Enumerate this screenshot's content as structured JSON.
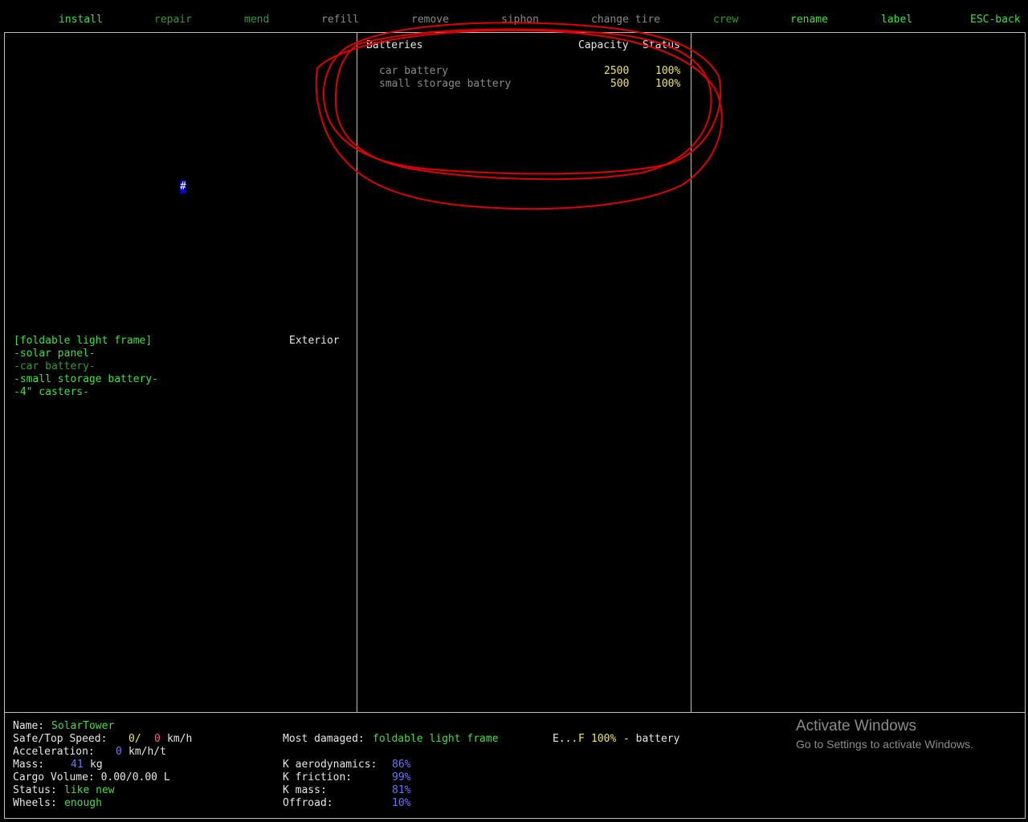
{
  "menu": [
    {
      "key": "install",
      "label": "install",
      "color": "green"
    },
    {
      "key": "repair",
      "label": "repair",
      "color": "dgreen"
    },
    {
      "key": "mend",
      "label": "mend",
      "color": "dgreen"
    },
    {
      "key": "refill",
      "label": "refill",
      "color": "gray"
    },
    {
      "key": "remove",
      "label": "remove",
      "color": "gray"
    },
    {
      "key": "siphon",
      "label": "siphon",
      "color": "gray"
    },
    {
      "key": "change_tire",
      "label": "change tire",
      "color": "gray"
    },
    {
      "key": "crew",
      "label": "crew",
      "color": "dgreen"
    },
    {
      "key": "rename",
      "label": "rename",
      "color": "green"
    },
    {
      "key": "label",
      "label": "label",
      "color": "green"
    },
    {
      "key": "esc_back",
      "label": "ESC-back",
      "color": "green"
    }
  ],
  "map": {
    "cursor_char": "#"
  },
  "parts": {
    "location": "Exterior",
    "items": [
      {
        "label": "[foldable light frame]",
        "color": "green"
      },
      {
        "label": "-solar panel-",
        "color": "green"
      },
      {
        "label": "-car battery-",
        "color": "dgreen"
      },
      {
        "label": "-small storage battery-",
        "color": "green"
      },
      {
        "label": "-4\" casters-",
        "color": "green"
      }
    ]
  },
  "batteries": {
    "header_name": "Batteries",
    "header_capacity": "Capacity",
    "header_status": "Status",
    "rows": [
      {
        "name": "car battery",
        "capacity": "2500",
        "status": "100%"
      },
      {
        "name": "small storage battery",
        "capacity": "500",
        "status": "100%"
      }
    ]
  },
  "stats": {
    "name_label": "Name: ",
    "name_value": "SolarTower",
    "speed_label": "Safe/Top Speed:",
    "speed_safe": "0/",
    "speed_top": "0",
    "speed_unit": "km/h",
    "accel_label": "Acceleration:",
    "accel_value": "0",
    "accel_unit": "km/h/t",
    "mass_label": "Mass:",
    "mass_value": "41",
    "mass_unit": "kg",
    "cargo": "Cargo Volume: 0.00/0.00 L",
    "status_label": "Status: ",
    "status_value": "like new",
    "wheels_label": "Wheels: ",
    "wheels_value": "enough",
    "damaged_label": "Most damaged: ",
    "damaged_value": "foldable light frame",
    "fuel_e": "E...",
    "fuel_f": "F",
    "fuel_pct": "100%",
    "fuel_type": "- battery",
    "k_aero_label": "K aerodynamics:",
    "k_aero_value": "86%",
    "k_fric_label": "K friction:",
    "k_fric_value": "99%",
    "k_mass_label": "K mass:",
    "k_mass_value": "81%",
    "offroad_label": "Offroad:",
    "offroad_value": "10%"
  },
  "watermark": {
    "title": "Activate Windows",
    "subtitle": "Go to Settings to activate Windows."
  }
}
